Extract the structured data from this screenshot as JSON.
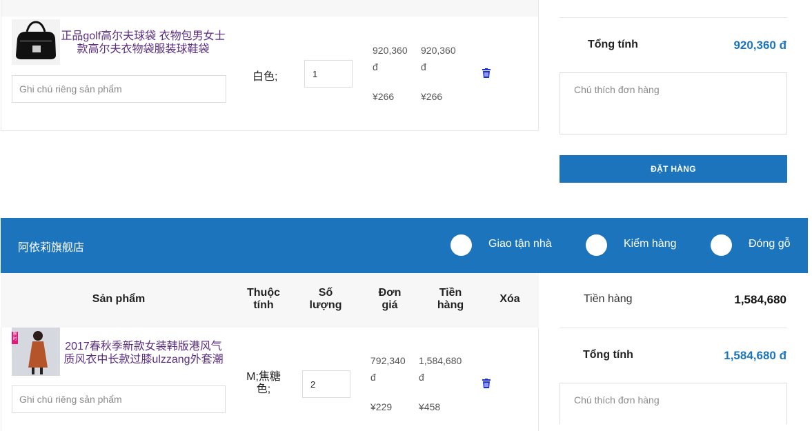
{
  "store1": {
    "product": {
      "title": "正品golf高尔夫球袋 衣物包男女士款高尔夫衣物袋服装球鞋袋",
      "attribute": "白色;",
      "quantity": "1",
      "unit_price_vnd": "920,360",
      "unit_price_currency": "đ",
      "unit_price_cny": "¥266",
      "total_vnd": "920,360",
      "total_currency": "đ",
      "total_cny": "¥266",
      "note_placeholder": "Ghi chú riêng sản phẩm"
    },
    "summary": {
      "total_label": "Tổng tính",
      "total_value": "920,360 đ",
      "order_note_placeholder": "Chú thích đơn hàng",
      "order_button": "ĐẶT HÀNG"
    }
  },
  "store2": {
    "name": "阿依莉旗舰店",
    "options": [
      "Giao tận nhà",
      "Kiểm hàng",
      "Đóng gỗ"
    ],
    "headers": {
      "product": "Sản phẩm",
      "attribute_l1": "Thuộc",
      "attribute_l2": "tính",
      "quantity_l1": "Số",
      "quantity_l2": "lượng",
      "unit_price_l1": "Đơn",
      "unit_price_l2": "giá",
      "total_l1": "Tiền",
      "total_l2": "hàng",
      "delete": "Xóa"
    },
    "product": {
      "title": "2017春秋季新款女装韩版港风气质风衣中长款过膝ulzzang外套潮",
      "attribute_l1": "M;焦糖",
      "attribute_l2": "色;",
      "quantity": "2",
      "unit_price_vnd": "792,340",
      "unit_price_currency": "đ",
      "unit_price_cny": "¥229",
      "total_vnd": "1,584,680",
      "total_currency": "đ",
      "total_cny": "¥458",
      "note_placeholder": "Ghi chú riêng sản phẩm",
      "badge": "限时"
    },
    "summary": {
      "goods_label": "Tiền hàng",
      "goods_value": "1,584,680",
      "total_label": "Tổng tính",
      "total_value": "1,584,680 đ",
      "order_note_placeholder": "Chú thích đơn hàng"
    }
  },
  "colors": {
    "accent": "#1c75bc",
    "title_purple": "#5a2d82",
    "trash_blue": "#1a2fd6"
  },
  "icons": {
    "delete": "trash-icon",
    "option": "radio-icon"
  }
}
